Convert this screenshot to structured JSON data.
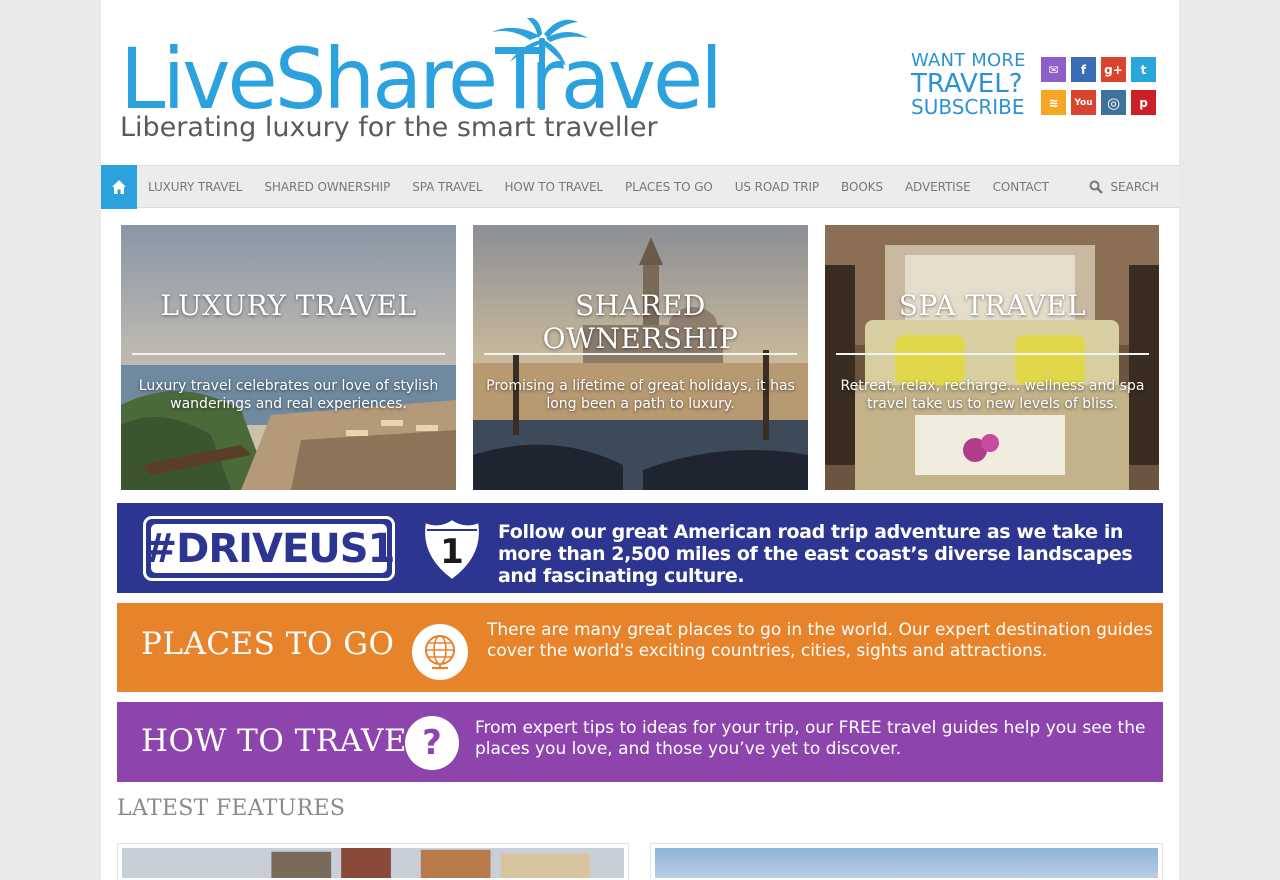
{
  "logo": {
    "text": "LiveShareTravel"
  },
  "tagline": "Liberating luxury for the smart traveller",
  "subscribe": {
    "line1": "WANT MORE",
    "line2": "TRAVEL?",
    "line3": "SUBSCRIBE"
  },
  "social": [
    {
      "icon": "email-icon",
      "color": "#8e5fc9",
      "glyph": "✉"
    },
    {
      "icon": "facebook-icon",
      "color": "#3b6cb7",
      "glyph": "f"
    },
    {
      "icon": "google-plus-icon",
      "color": "#d9442f",
      "glyph": "g+"
    },
    {
      "icon": "twitter-icon",
      "color": "#2aa6dc",
      "glyph": "t"
    },
    {
      "icon": "rss-icon",
      "color": "#f5a623",
      "glyph": "≋"
    },
    {
      "icon": "youtube-icon",
      "color": "#d9442f",
      "glyph": "You"
    },
    {
      "icon": "instagram-icon",
      "color": "#3f729b",
      "glyph": "◎"
    },
    {
      "icon": "pinterest-icon",
      "color": "#cb2027",
      "glyph": "p"
    }
  ],
  "nav": {
    "items": [
      "LUXURY TRAVEL",
      "SHARED OWNERSHIP",
      "SPA TRAVEL",
      "HOW TO TRAVEL",
      "PLACES TO GO",
      "US ROAD TRIP",
      "BOOKS",
      "ADVERTISE",
      "CONTACT"
    ],
    "search_label": "SEARCH"
  },
  "cards": [
    {
      "title": "LUXURY TRAVEL",
      "desc": "Luxury travel celebrates our love of stylish wanderings and real experiences."
    },
    {
      "title": "SHARED OWNERSHIP",
      "desc": "Promising a lifetime of great holidays, it has long been a path to luxury."
    },
    {
      "title": "SPA TRAVEL",
      "desc": "Retreat, relax, recharge... wellness and spa travel take us to new levels of bliss."
    }
  ],
  "driveus": {
    "tag": "#DRIVEUS1",
    "shield_number": "1",
    "text": "Follow our great American road trip adventure as we take in more than 2,500 miles of the east coast’s diverse landscapes and fascinating culture."
  },
  "places": {
    "title": "PLACES TO GO",
    "text": "There are many great places to go in the world. Our expert destination guides cover the world's exciting countries, cities, sights and attractions."
  },
  "howto": {
    "title": "HOW TO TRAVEL",
    "icon_glyph": "?",
    "text": "From expert tips to ideas for your trip, our FREE travel guides help you see the places you love, and those you’ve yet to discover."
  },
  "latest_heading": "LATEST FEATURES",
  "colors": {
    "brand_blue": "#2ba2de",
    "drive_blue": "#2c3590",
    "places_orange": "#e7832a",
    "howto_purple": "#8e44ad"
  }
}
